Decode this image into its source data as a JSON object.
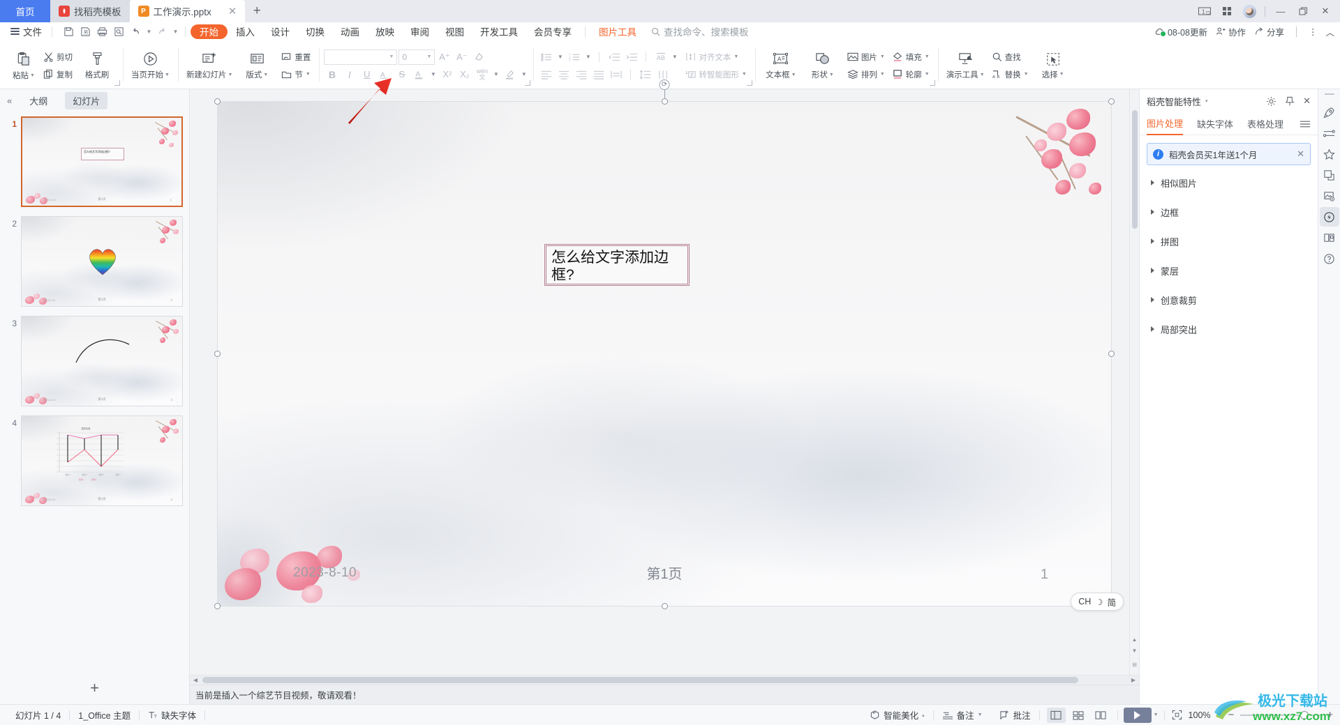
{
  "window": {
    "tabs": [
      {
        "name": "home-tab",
        "label": "首页",
        "type": "home"
      },
      {
        "name": "template-tab",
        "label": "找稻壳模板",
        "type": "template",
        "icon": "doc-hunt-icon"
      },
      {
        "name": "document-tab",
        "label": "工作演示.pptx",
        "type": "document",
        "icon": "ppt-icon",
        "active": true
      }
    ],
    "new_tab_label": "+",
    "controls": {
      "tab_count": "1",
      "grid": "grid-icon",
      "minimize": "—",
      "restore": "❐",
      "close": "✕"
    }
  },
  "menubar": {
    "file_label": "文件",
    "quick_access": [
      "save-icon",
      "save-as-icon",
      "print-icon",
      "print-preview-icon",
      "undo-icon",
      "redo-icon",
      "customize-icon"
    ],
    "menus": [
      {
        "label": "开始",
        "active": true
      },
      {
        "label": "插入"
      },
      {
        "label": "设计"
      },
      {
        "label": "切换"
      },
      {
        "label": "动画"
      },
      {
        "label": "放映"
      },
      {
        "label": "审阅"
      },
      {
        "label": "视图"
      },
      {
        "label": "开发工具"
      },
      {
        "label": "会员专享"
      },
      {
        "label": "图片工具",
        "context": true
      }
    ],
    "search_placeholder": "查找命令、搜索模板",
    "right": [
      {
        "label": "08-08更新",
        "icon": "cloud-update-icon"
      },
      {
        "label": "协作",
        "icon": "collab-icon"
      },
      {
        "label": "分享",
        "icon": "share-icon"
      }
    ],
    "more": "⋮",
    "collapse": "︿"
  },
  "ribbon": {
    "clipboard": {
      "paste": "粘贴",
      "cut": "剪切",
      "copy": "复制",
      "format_painter": "格式刷"
    },
    "start_show": {
      "label": "当页开始"
    },
    "slides": {
      "new_slide": "新建幻灯片",
      "layout": "版式",
      "reset": "重置",
      "section": "节"
    },
    "font": {
      "name_value": "",
      "size_value": "0",
      "grow": "A⁺",
      "shrink": "A⁻",
      "clear_format": "clear-format-icon",
      "bold": "B",
      "italic": "I",
      "underline": "U",
      "shadow": "A",
      "strikethrough": "S",
      "font_color": "A",
      "superscript": "X²",
      "subscript": "X₂",
      "pinyin": "wén",
      "highlight": "highlight-icon"
    },
    "paragraph": {
      "bullets": "bullets-icon",
      "numbering": "numbering-icon",
      "decrease_indent": "decrease-indent-icon",
      "increase_indent": "increase-indent-icon",
      "text_direction": "AB",
      "align_left": "align-left-icon",
      "align_center": "align-center-icon",
      "align_right": "align-right-icon",
      "align_justify": "align-justify-icon",
      "align_distributed": "align-distributed-icon",
      "line_spacing": "line-spacing-icon",
      "column": "column-icon",
      "align_text": "对齐文本",
      "to_smartart": "转智能图形"
    },
    "insert": {
      "textbox": "文本框",
      "shape": "形状",
      "picture": "图片",
      "arrange": "排列",
      "fill": "填充",
      "outline": "轮廓"
    },
    "tools": {
      "present_tool": "演示工具",
      "find": "查找",
      "replace": "替换",
      "select": "选择"
    }
  },
  "slide_panel": {
    "collapse_icon": "collapse-left-icon",
    "tabs": [
      {
        "label": "大纲",
        "active": false
      },
      {
        "label": "幻灯片",
        "active": true
      }
    ],
    "slides": [
      {
        "number": "1",
        "selected": true,
        "kind": "textbox",
        "text": "怎么给文字添加边框?",
        "footer_center": "第1页",
        "page": "1",
        "date": "2023-8-10"
      },
      {
        "number": "2",
        "selected": false,
        "kind": "heart",
        "footer_center": "第2页",
        "page": "2",
        "date": "2023-8-10"
      },
      {
        "number": "3",
        "selected": false,
        "kind": "arc",
        "footer_center": "第3页",
        "page": "3",
        "date": "2023-8-10"
      },
      {
        "number": "4",
        "selected": false,
        "kind": "chart",
        "footer_center": "第4页",
        "page": "4",
        "date": "2023-8-10"
      }
    ],
    "add_slide": "+"
  },
  "slide": {
    "textbox_text": "怎么给文字添加边框?",
    "date": "2023-8-10",
    "footer_center": "第1页",
    "page_number": "1"
  },
  "notes": {
    "text": "当前是插入一个综艺节目视频，敬请观看！"
  },
  "right_pane": {
    "title": "稻壳智能特性",
    "title_caret": "▾",
    "header_icons": [
      "gear-icon",
      "pin-icon",
      "close-icon"
    ],
    "tabs": [
      {
        "label": "图片处理",
        "active": true
      },
      {
        "label": "缺失字体",
        "active": false
      },
      {
        "label": "表格处理",
        "active": false
      }
    ],
    "menu_icon": "list-menu-icon",
    "promo": {
      "text": "稻壳会员买1年送1个月",
      "close": "✕"
    },
    "accordion": [
      {
        "label": "相似图片"
      },
      {
        "label": "边框"
      },
      {
        "label": "拼图"
      },
      {
        "label": "蒙层"
      },
      {
        "label": "创意裁剪"
      },
      {
        "label": "局部突出"
      }
    ]
  },
  "rail": {
    "items": [
      {
        "name": "rocket-icon",
        "active": false
      },
      {
        "name": "sliders-icon",
        "active": false
      },
      {
        "name": "star-icon",
        "active": false
      },
      {
        "name": "shapes-icon",
        "active": false
      },
      {
        "name": "image-tools-icon",
        "active": false
      },
      {
        "name": "smart-feature-icon",
        "active": true
      },
      {
        "name": "book-search-icon",
        "active": false
      },
      {
        "name": "help-icon",
        "active": false
      }
    ]
  },
  "ime": {
    "mode": "CH",
    "moon": "☽",
    "script": "简"
  },
  "statusbar": {
    "slide_count": "幻灯片 1 / 4",
    "theme": "1_Office 主题",
    "missing_font": "缺失字体",
    "beautify": "智能美化",
    "beautify_caret": "▴",
    "notes": "备注",
    "comments": "批注",
    "views": [
      {
        "name": "normal-view",
        "active": true
      },
      {
        "name": "slide-sorter-view",
        "active": false
      },
      {
        "name": "reading-view",
        "active": false
      }
    ],
    "play": "play-icon",
    "fit": "fit-icon",
    "zoom": "100%",
    "zoom_minus": "−",
    "zoom_plus": "+"
  },
  "watermark": {
    "top": "极光下载站",
    "bottom": "www.xz7.com"
  },
  "colors": {
    "accent_orange": "#f4652d",
    "home_blue": "#4a7cf0",
    "promo_blue": "#2c7ef0",
    "selected_thumb": "#d2662c",
    "arrow_red": "#e8261c"
  }
}
